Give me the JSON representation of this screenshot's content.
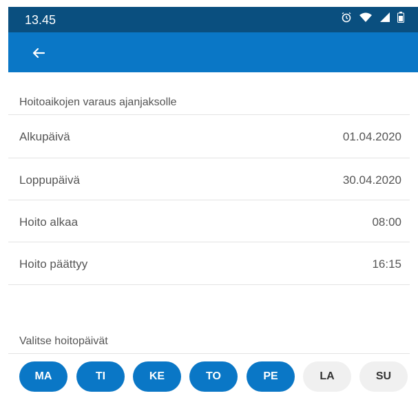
{
  "status_bar": {
    "time": "13.45",
    "icons": [
      "alarm-icon",
      "wifi-icon",
      "signal-icon",
      "battery-icon"
    ]
  },
  "app_bar": {
    "back_icon": "back-arrow-icon"
  },
  "form": {
    "section_title": "Hoitoaikojen varaus ajanjaksolle",
    "rows": [
      {
        "label": "Alkupäivä",
        "value": "01.04.2020"
      },
      {
        "label": "Loppupäivä",
        "value": "30.04.2020"
      },
      {
        "label": "Hoito alkaa",
        "value": "08:00"
      },
      {
        "label": "Hoito päättyy",
        "value": "16:15"
      }
    ]
  },
  "days_section": {
    "title": "Valitse hoitopäivät",
    "days": [
      {
        "label": "MA",
        "selected": true
      },
      {
        "label": "TI",
        "selected": true
      },
      {
        "label": "KE",
        "selected": true
      },
      {
        "label": "TO",
        "selected": true
      },
      {
        "label": "PE",
        "selected": true
      },
      {
        "label": "LA",
        "selected": false
      },
      {
        "label": "SU",
        "selected": false
      }
    ]
  },
  "colors": {
    "status_bar": "#0a4f7f",
    "app_bar": "#0a77c6",
    "selected_day": "#0a77c6",
    "unselected_day": "#f0f0f0"
  }
}
